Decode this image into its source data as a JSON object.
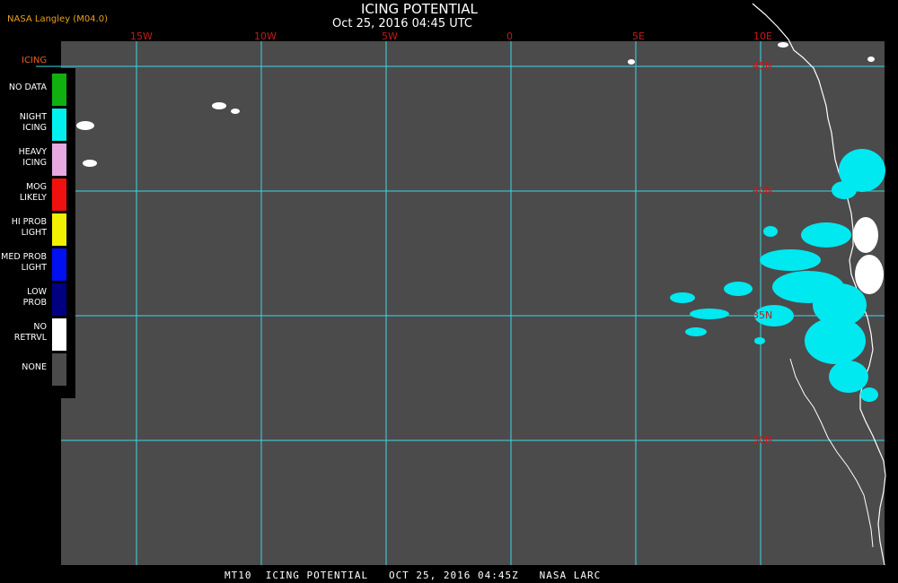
{
  "header": {
    "title": "ICING POTENTIAL",
    "datetime": "Oct 25, 2016 04:45 UTC",
    "credit": "NASA Langley (M04.0)"
  },
  "map": {
    "longitude_labels": [
      "15W",
      "10W",
      "5W",
      "0",
      "5E",
      "10E"
    ],
    "latitude_labels": [
      "45N",
      "40N",
      "35N",
      "30N"
    ],
    "gridline_color": "#3ad8e0",
    "ocean_color": "#4b4b4b",
    "coast_color": "#ffffff",
    "icing_color": "#00e8f0"
  },
  "legend": {
    "title": "ICING",
    "items": [
      {
        "label": "NO DATA",
        "color": "#10b010"
      },
      {
        "label": "NIGHT\nICING",
        "color": "#00f0f0"
      },
      {
        "label": "HEAVY\nICING",
        "color": "#e8a8e0"
      },
      {
        "label": "MOG\nLIKELY",
        "color": "#f01010"
      },
      {
        "label": "HI PROB\nLIGHT",
        "color": "#f0f000"
      },
      {
        "label": "MED PROB\nLIGHT",
        "color": "#0010f0"
      },
      {
        "label": "LOW\nPROB",
        "color": "#000080"
      },
      {
        "label": "NO\nRETRVL",
        "color": "#ffffff"
      },
      {
        "label": "NONE",
        "color": "#4b4b4b"
      }
    ]
  },
  "footer": {
    "caption": "MT10  ICING POTENTIAL   OCT 25, 2016 04:45Z   NASA LARC"
  }
}
